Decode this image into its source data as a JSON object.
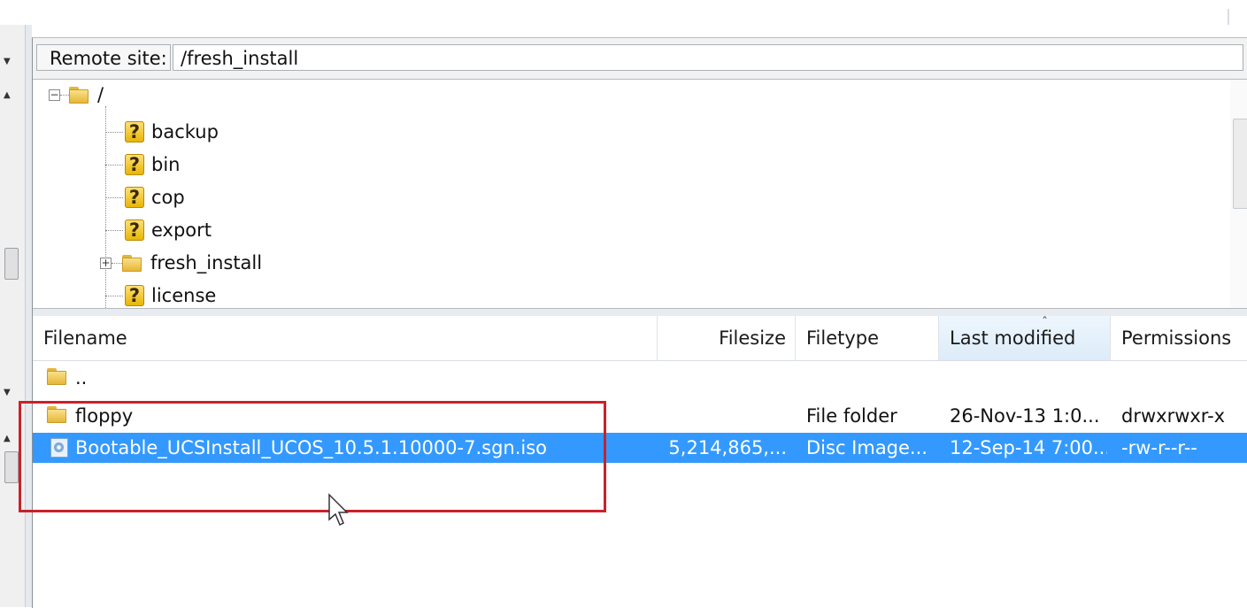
{
  "remote": {
    "label": "Remote site:",
    "path": "/fresh_install"
  },
  "tree": {
    "root": "/",
    "items": [
      {
        "label": "backup",
        "icon": "unknown-question-icon"
      },
      {
        "label": "bin",
        "icon": "unknown-question-icon"
      },
      {
        "label": "cop",
        "icon": "unknown-question-icon"
      },
      {
        "label": "export",
        "icon": "unknown-question-icon"
      },
      {
        "label": "fresh_install",
        "icon": "folder-icon"
      },
      {
        "label": "license",
        "icon": "unknown-question-icon"
      }
    ]
  },
  "file_list": {
    "columns": [
      "Filename",
      "Filesize",
      "Filetype",
      "Last modified",
      "Permissions"
    ],
    "sorted_column": "Last modified",
    "rows": [
      {
        "name": "..",
        "size": "",
        "type": "",
        "modified": "",
        "perms": "",
        "icon": "folder-icon"
      },
      {
        "name": "floppy",
        "size": "",
        "type": "File folder",
        "modified": "26-Nov-13 1:0...",
        "perms": "drwxrwxr-x",
        "icon": "folder-icon"
      },
      {
        "name": "Bootable_UCSInstall_UCOS_10.5.1.10000-7.sgn.iso",
        "size": "5,214,865,...",
        "type": "Disc Image...",
        "modified": "12-Sep-14 7:00...",
        "perms": "-rw-r--r--",
        "icon": "disc-image-icon",
        "selected": true
      }
    ]
  },
  "colors": {
    "selection": "#3399ff",
    "highlight_box": "#c8222b"
  }
}
